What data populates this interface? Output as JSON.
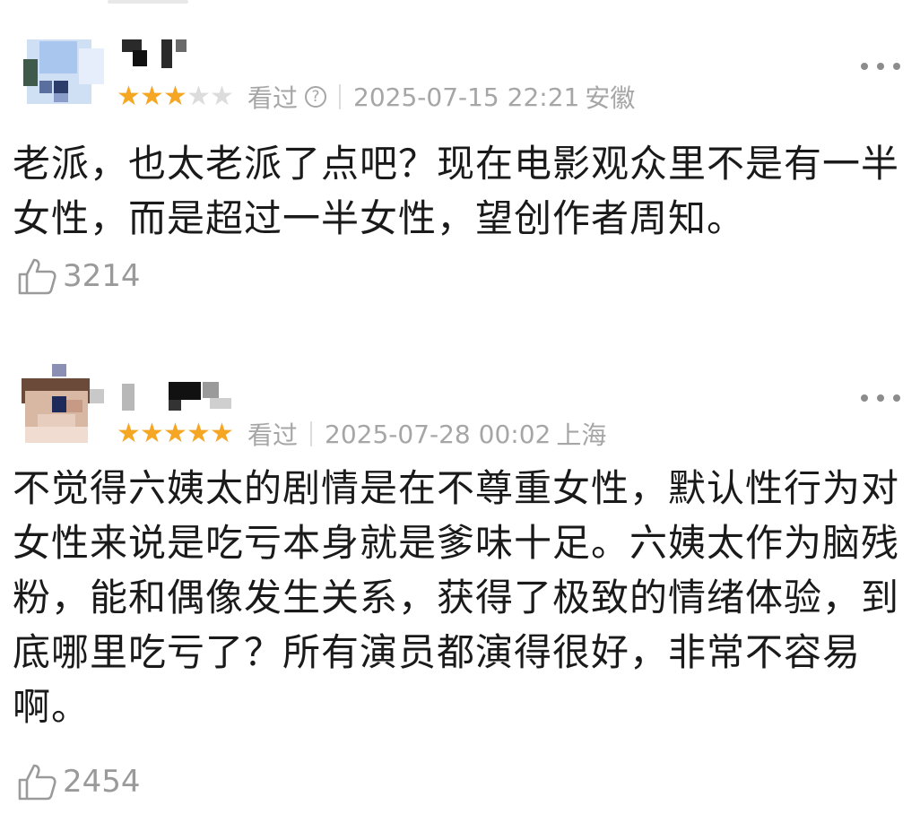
{
  "reviews": [
    {
      "rating": 3,
      "max_rating": 5,
      "watched_label": "看过",
      "help_icon_glyph": "?",
      "date": "2025-07-15 22:21",
      "location": "安徽",
      "text_lines": [
        "老派，也太老派了点吧？现在电影观众里不是有一半",
        "女性，而是超过一半女性，望创作者周知。"
      ],
      "likes": "3214",
      "icons": [
        "more-icon",
        "thumbs-up-icon",
        "help-icon"
      ]
    },
    {
      "rating": 5,
      "max_rating": 5,
      "watched_label": "看过",
      "date": "2025-07-28 00:02",
      "location": "上海",
      "text_lines": [
        "不觉得六姨太的剧情是在不尊重女性，默认性行为对",
        "女性来说是吃亏本身就是爹味十足。六姨太作为脑残",
        "粉，能和偶像发生关系，获得了极致的情绪体验，到",
        "底哪里吃亏了？所有演员都演得很好，非常不容易",
        "啊。"
      ],
      "likes": "2454",
      "icons": [
        "more-icon",
        "thumbs-up-icon"
      ]
    }
  ],
  "colors": {
    "star_on": "#f5a623",
    "star_off": "#dcdcdc",
    "meta_text": "#a6a6a6"
  }
}
